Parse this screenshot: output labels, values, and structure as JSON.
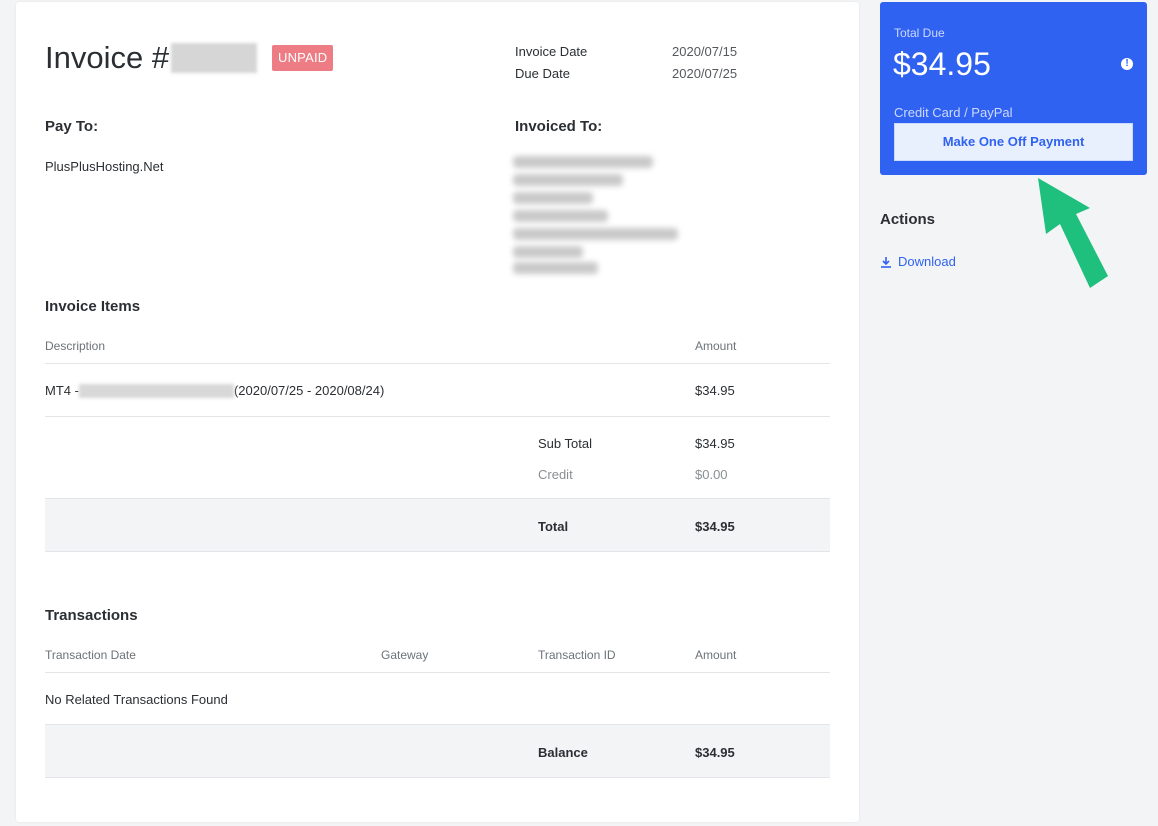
{
  "invoice": {
    "title_prefix": "Invoice #",
    "status": "UNPAID",
    "invoice_date_label": "Invoice Date",
    "invoice_date": "2020/07/15",
    "due_date_label": "Due Date",
    "due_date": "2020/07/25"
  },
  "pay_to": {
    "heading": "Pay To:",
    "name": "PlusPlusHosting.Net"
  },
  "invoiced_to": {
    "heading": "Invoiced To:"
  },
  "items": {
    "heading": "Invoice Items",
    "col_description": "Description",
    "col_amount": "Amount",
    "rows": [
      {
        "prefix": "MT4 - ",
        "period": "(2020/07/25 - 2020/08/24)",
        "amount": "$34.95"
      }
    ],
    "subtotal_label": "Sub Total",
    "subtotal": "$34.95",
    "credit_label": "Credit",
    "credit": "$0.00",
    "total_label": "Total",
    "total": "$34.95"
  },
  "transactions": {
    "heading": "Transactions",
    "col_date": "Transaction Date",
    "col_gateway": "Gateway",
    "col_id": "Transaction ID",
    "col_amount": "Amount",
    "empty": "No Related Transactions Found",
    "balance_label": "Balance",
    "balance": "$34.95"
  },
  "sidebar": {
    "total_due_label": "Total Due",
    "total_due": "$34.95",
    "info_glyph": "!",
    "method": "Credit Card / PayPal",
    "pay_button": "Make One Off Payment",
    "actions_heading": "Actions",
    "download_label": "Download"
  },
  "colors": {
    "primary": "#2f62f0",
    "unpaid_badge": "#ee7c84",
    "annotation_arrow": "#1fbf7d"
  },
  "icons": {
    "download": "download-icon",
    "info": "info-icon",
    "annotation": "arrow-icon"
  }
}
